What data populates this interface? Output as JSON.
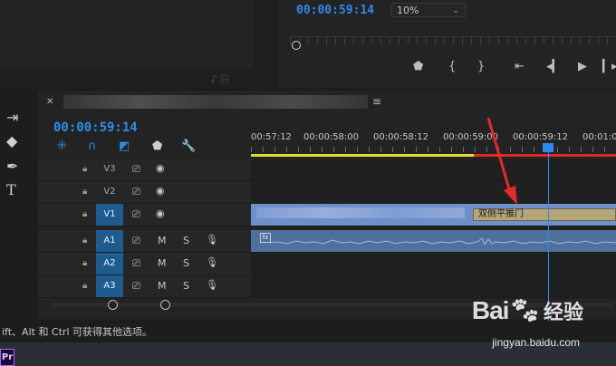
{
  "program_monitor": {
    "timecode": "00:00:59:14",
    "zoom": "10%"
  },
  "timeline": {
    "timecode": "00:00:59:14",
    "ruler_labels": [
      "00:57:12",
      "00:00:58:00",
      "00:00:58:12",
      "00:00:59:00",
      "00:00:59:12",
      "00:01:0"
    ],
    "video_tracks": [
      "V3",
      "V2",
      "V1"
    ],
    "audio_tracks": [
      "A1",
      "A2",
      "A3"
    ],
    "mute_label": "M",
    "solo_label": "S",
    "transition_label": "双侧平推门",
    "fx_label": "fx"
  },
  "status_bar": {
    "text": "ift、Alt 和 Ctrl 可获得其他选项。"
  },
  "taskbar": {
    "pr_label": "Pr"
  },
  "watermark": {
    "main": "Bai",
    "suffix": "经验",
    "url": "jingyan.baidu.com"
  },
  "colors": {
    "accent_blue": "#2d8ceb",
    "work_area_yellow": "#e3d83a",
    "work_area_red": "#e02a2a",
    "video_clip": "#6f8fc9",
    "audio_clip": "#4f6f9c",
    "transition": "#b4a57a",
    "arrow_red": "#e32b2b"
  }
}
